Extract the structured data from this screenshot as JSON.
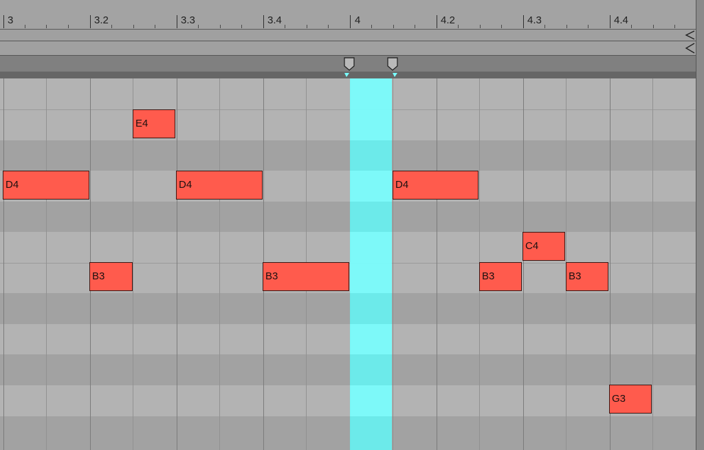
{
  "ruler": {
    "bars": [
      {
        "label": "3"
      },
      {
        "label": "3.2"
      },
      {
        "label": "3.3"
      },
      {
        "label": "3.4"
      },
      {
        "label": "4"
      },
      {
        "label": "4.2"
      },
      {
        "label": "4.3"
      },
      {
        "label": "4.4"
      }
    ]
  },
  "notes": [
    {
      "label": "E4"
    },
    {
      "label": "D4"
    },
    {
      "label": "D4"
    },
    {
      "label": "D4"
    },
    {
      "label": "C4"
    },
    {
      "label": "B3"
    },
    {
      "label": "B3"
    },
    {
      "label": "B3"
    },
    {
      "label": "B3"
    },
    {
      "label": "G3"
    }
  ],
  "colors": {
    "note_fill": "#ff5b4d",
    "playhead_highlight": "#7affff",
    "grid_light": "#b3b3b3",
    "grid_dark": "#a2a2a2"
  },
  "icons": [
    "loop-start-marker-icon",
    "loop-end-marker-icon",
    "collapse-arrow-icon"
  ]
}
